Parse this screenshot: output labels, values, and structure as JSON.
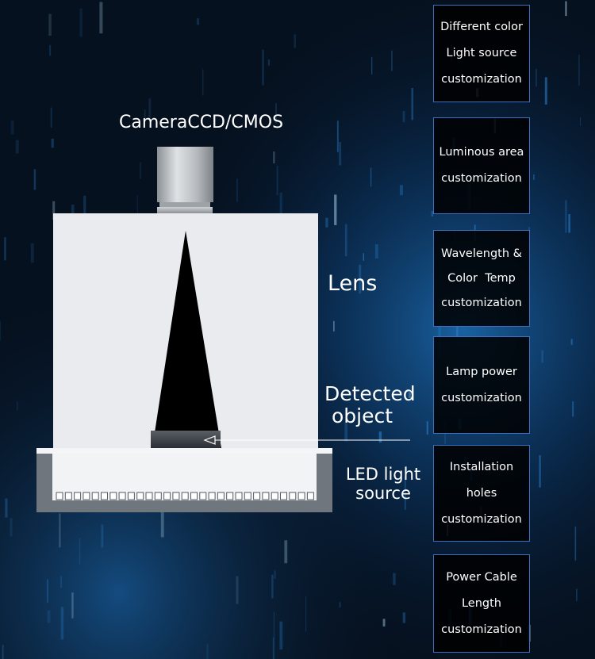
{
  "colors": {
    "background": "#06111f",
    "accent_glow": "#1d7fd0",
    "housing": "#e9ebee",
    "card_border": "#3d6fc0",
    "card_fill": "#000000",
    "text": "#ffffff"
  },
  "diagram": {
    "camera_label": "CameraCCD/CMOS",
    "lens_label": "Lens",
    "detected_label_line1": "Detected",
    "detected_label_line2": "object",
    "led_label_line1": "LED light",
    "led_label_line2": "source"
  },
  "features": [
    {
      "lines": [
        "Different color",
        "Light source",
        "customization"
      ]
    },
    {
      "lines": [
        "Luminous area",
        "customization"
      ]
    },
    {
      "lines": [
        "Wavelength &",
        "Color  Temp",
        "customization"
      ]
    },
    {
      "lines": [
        "Lamp power",
        "customization"
      ]
    },
    {
      "lines": [
        "Installation",
        "holes",
        "customization"
      ]
    },
    {
      "lines": [
        "Power Cable",
        "Length",
        "customization"
      ]
    }
  ]
}
